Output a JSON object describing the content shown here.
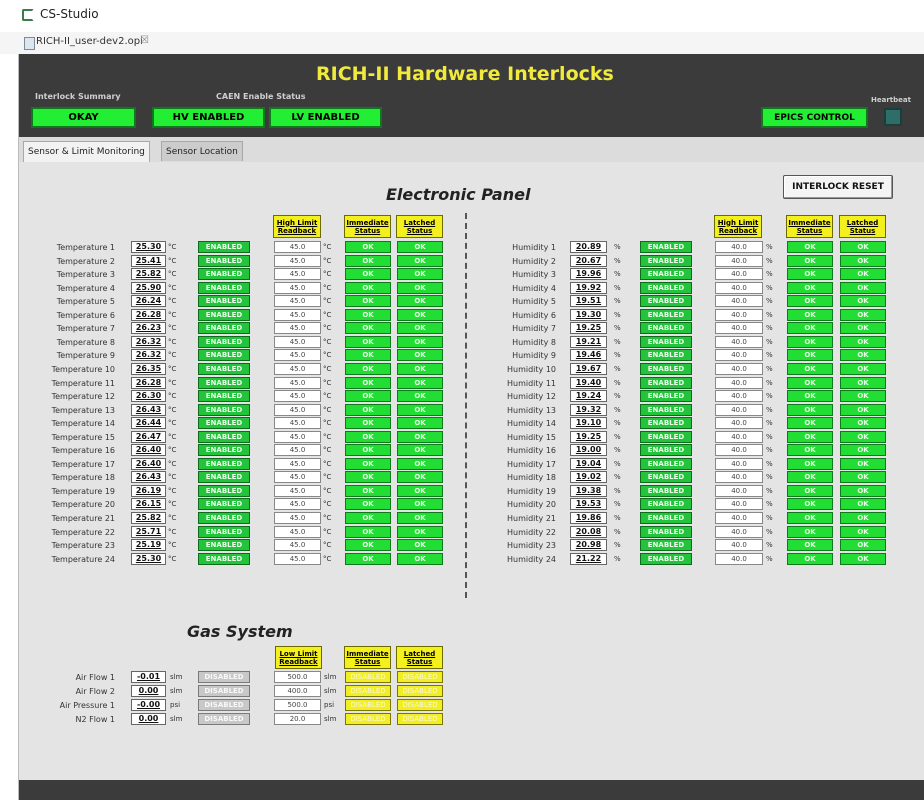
{
  "window": {
    "app_title": "CS-Studio",
    "file_tab": "RICH-II_user-dev2.opi",
    "tab_close": "☒"
  },
  "header": {
    "title": "RICH-II Hardware Interlocks",
    "interlock_summary_label": "Interlock Summary",
    "interlock_summary_value": "OKAY",
    "caen_label": "CAEN Enable Status",
    "hv_status": "HV ENABLED",
    "lv_status": "LV ENABLED",
    "epics_control": "EPICS CONTROL",
    "heartbeat_label": "Heartbeat"
  },
  "view_tabs": [
    "Sensor & Limit Monitoring",
    "Sensor Location"
  ],
  "electronic_panel": {
    "title": "Electronic Panel",
    "reset_button": "INTERLOCK RESET",
    "col_high_limit": [
      "High Limit",
      "Readback"
    ],
    "col_immediate": [
      "Immediate",
      "Status"
    ],
    "col_latched": [
      "Latched",
      "Status"
    ],
    "temp_unit": "°C",
    "hum_unit": "%",
    "enabled_text": "ENABLED",
    "ok_text": "OK",
    "temp_limit": "45.0",
    "hum_limit": "40.0",
    "temperatures": [
      {
        "label": "Temperature 1",
        "value": "25.30"
      },
      {
        "label": "Temperature 2",
        "value": "25.41"
      },
      {
        "label": "Temperature 3",
        "value": "25.82"
      },
      {
        "label": "Temperature 4",
        "value": "25.90"
      },
      {
        "label": "Temperature 5",
        "value": "26.24"
      },
      {
        "label": "Temperature 6",
        "value": "26.28"
      },
      {
        "label": "Temperature 7",
        "value": "26.23"
      },
      {
        "label": "Temperature 8",
        "value": "26.32"
      },
      {
        "label": "Temperature 9",
        "value": "26.32"
      },
      {
        "label": "Temperature 10",
        "value": "26.35"
      },
      {
        "label": "Temperature 11",
        "value": "26.28"
      },
      {
        "label": "Temperature 12",
        "value": "26.30"
      },
      {
        "label": "Temperature 13",
        "value": "26.43"
      },
      {
        "label": "Temperature 14",
        "value": "26.44"
      },
      {
        "label": "Temperature 15",
        "value": "26.47"
      },
      {
        "label": "Temperature 16",
        "value": "26.40"
      },
      {
        "label": "Temperature 17",
        "value": "26.40"
      },
      {
        "label": "Temperature 18",
        "value": "26.43"
      },
      {
        "label": "Temperature 19",
        "value": "26.19"
      },
      {
        "label": "Temperature 20",
        "value": "26.15"
      },
      {
        "label": "Temperature 21",
        "value": "25.82"
      },
      {
        "label": "Temperature 22",
        "value": "25.71"
      },
      {
        "label": "Temperature 23",
        "value": "25.19"
      },
      {
        "label": "Temperature 24",
        "value": "25.30"
      }
    ],
    "humidities": [
      {
        "label": "Humidity 1",
        "value": "20.89"
      },
      {
        "label": "Humidity 2",
        "value": "20.67"
      },
      {
        "label": "Humidity 3",
        "value": "19.96"
      },
      {
        "label": "Humidity 4",
        "value": "19.92"
      },
      {
        "label": "Humidity 5",
        "value": "19.51"
      },
      {
        "label": "Humidity 6",
        "value": "19.30"
      },
      {
        "label": "Humidity 7",
        "value": "19.25"
      },
      {
        "label": "Humidity 8",
        "value": "19.21"
      },
      {
        "label": "Humidity 9",
        "value": "19.46"
      },
      {
        "label": "Humidity 10",
        "value": "19.67"
      },
      {
        "label": "Humidity 11",
        "value": "19.40"
      },
      {
        "label": "Humidity 12",
        "value": "19.24"
      },
      {
        "label": "Humidity 13",
        "value": "19.32"
      },
      {
        "label": "Humidity 14",
        "value": "19.10"
      },
      {
        "label": "Humidity 15",
        "value": "19.25"
      },
      {
        "label": "Humidity 16",
        "value": "19.00"
      },
      {
        "label": "Humidity 17",
        "value": "19.04"
      },
      {
        "label": "Humidity 18",
        "value": "19.02"
      },
      {
        "label": "Humidity 19",
        "value": "19.38"
      },
      {
        "label": "Humidity 20",
        "value": "19.53"
      },
      {
        "label": "Humidity 21",
        "value": "19.86"
      },
      {
        "label": "Humidity 22",
        "value": "20.08"
      },
      {
        "label": "Humidity 23",
        "value": "20.98"
      },
      {
        "label": "Humidity 24",
        "value": "21.22"
      }
    ]
  },
  "gas_system": {
    "title": "Gas System",
    "col_low_limit": [
      "Low Limit",
      "Readback"
    ],
    "col_immediate": [
      "Immediate",
      "Status"
    ],
    "col_latched": [
      "Latched",
      "Status"
    ],
    "disabled_text": "DISABLED",
    "rows": [
      {
        "label": "Air Flow 1",
        "value": "-0.01",
        "unit": "slm",
        "limit": "500.0",
        "limit_unit": "slm"
      },
      {
        "label": "Air Flow 2",
        "value": "0.00",
        "unit": "slm",
        "limit": "400.0",
        "limit_unit": "slm"
      },
      {
        "label": "Air Pressure 1",
        "value": "-0.00",
        "unit": "psi",
        "limit": "500.0",
        "limit_unit": "psi"
      },
      {
        "label": "N2 Flow 1",
        "value": "0.00",
        "unit": "slm",
        "limit": "20.0",
        "limit_unit": "slm"
      }
    ]
  },
  "colors": {
    "header_bg": "#3b3b3b",
    "title_yellow": "#f0ea3c",
    "led_green": "#22ee33",
    "panel_bg": "#e4e4e4",
    "disabled_gray": "#c8c8c8",
    "header_yellow": "#f3f01e"
  }
}
